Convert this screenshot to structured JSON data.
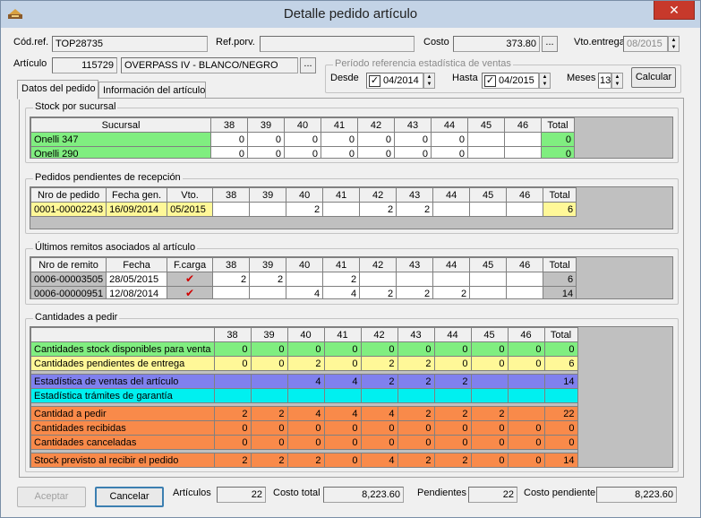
{
  "window": {
    "title": "Detalle pedido artículo",
    "close_label": "✕"
  },
  "header": {
    "codref_label": "Cód.ref.",
    "codref_value": "TOP28735",
    "refporv_label": "Ref.porv.",
    "refporv_value": "",
    "costo_label": "Costo",
    "costo_value": "373.80",
    "vto_label": "Vto.entrega",
    "vto_value": "08/2015",
    "articulo_label": "Artículo",
    "articulo_code": "115729",
    "articulo_desc": "OVERPASS IV - BLANCO/NEGRO",
    "dots_label": "...",
    "periodo_legend": "Período referencia estadística de ventas",
    "desde_label": "Desde",
    "desde_value": "04/2014",
    "hasta_label": "Hasta",
    "hasta_value": "04/2015",
    "meses_label": "Meses",
    "meses_value": "13",
    "calcular_label": "Calcular"
  },
  "tabs": [
    {
      "label": "Datos del pedido"
    },
    {
      "label": "Información del artículo"
    }
  ],
  "sizes": [
    "38",
    "39",
    "40",
    "41",
    "42",
    "43",
    "44",
    "45",
    "46"
  ],
  "total_label": "Total",
  "stock": {
    "legend": "Stock por sucursal",
    "col_label": "Sucursal",
    "rows": [
      {
        "name": "Onelli 347",
        "values": [
          "0",
          "0",
          "0",
          "0",
          "0",
          "0",
          "0",
          "",
          ""
        ],
        "total": "0"
      },
      {
        "name": "Onelli 290",
        "values": [
          "0",
          "0",
          "0",
          "0",
          "0",
          "0",
          "0",
          "",
          ""
        ],
        "total": "0"
      }
    ]
  },
  "pedidos": {
    "legend": "Pedidos pendientes de recepción",
    "cols": [
      "Nro de pedido",
      "Fecha gen.",
      "Vto."
    ],
    "rows": [
      {
        "nro": "0001-00002243",
        "fecha": "16/09/2014",
        "vto": "05/2015",
        "values": [
          "",
          "",
          "2",
          "",
          "2",
          "2",
          "",
          "",
          ""
        ],
        "total": "6"
      }
    ]
  },
  "remitos": {
    "legend": "Últimos remitos asociados al artículo",
    "cols": [
      "Nro de remito",
      "Fecha",
      "F.carga"
    ],
    "rows": [
      {
        "nro": "0006-00003505",
        "fecha": "28/05/2015",
        "fcarga_icon": "red-check-icon",
        "fcarga_glyph": "✔",
        "values": [
          "2",
          "2",
          "",
          "2",
          "",
          "",
          "",
          "",
          ""
        ],
        "total": "6"
      },
      {
        "nro": "0006-00000951",
        "fecha": "12/08/2014",
        "fcarga_icon": "red-check-icon",
        "fcarga_glyph": "✔",
        "values": [
          "",
          "",
          "4",
          "4",
          "2",
          "2",
          "2",
          "",
          ""
        ],
        "total": "14"
      }
    ]
  },
  "cantidades": {
    "legend": "Cantidades a pedir",
    "rows": [
      {
        "label": "Cantidades stock disponibles para venta",
        "color": "#80ee80",
        "values": [
          "0",
          "0",
          "0",
          "0",
          "0",
          "0",
          "0",
          "0",
          "0"
        ],
        "total": "0"
      },
      {
        "label": "Cantidades pendientes de entrega",
        "color": "#fff898",
        "values": [
          "0",
          "0",
          "2",
          "0",
          "2",
          "2",
          "0",
          "0",
          "0"
        ],
        "total": "6"
      },
      {
        "label": "Estadística de ventas del artículo",
        "color": "#8080ee",
        "values": [
          "",
          "",
          "4",
          "4",
          "2",
          "2",
          "2",
          "",
          ""
        ],
        "total": "14"
      },
      {
        "label": "Estadística trámites de garantía",
        "color": "#00f0f0",
        "values": [
          "",
          "",
          "",
          "",
          "",
          "",
          "",
          "",
          ""
        ],
        "total": ""
      },
      {
        "label": "Cantidad a pedir",
        "color": "#f98a4a",
        "values": [
          "2",
          "2",
          "4",
          "4",
          "4",
          "2",
          "2",
          "2",
          ""
        ],
        "total": "22"
      },
      {
        "label": "Cantidades recibidas",
        "color": "#f98a4a",
        "values": [
          "0",
          "0",
          "0",
          "0",
          "0",
          "0",
          "0",
          "0",
          "0"
        ],
        "total": "0"
      },
      {
        "label": "Cantidades canceladas",
        "color": "#f98a4a",
        "values": [
          "0",
          "0",
          "0",
          "0",
          "0",
          "0",
          "0",
          "0",
          "0"
        ],
        "total": "0"
      },
      {
        "label": "Stock previsto al recibir el pedido",
        "color": "#f98a4a",
        "values": [
          "2",
          "2",
          "2",
          "0",
          "4",
          "2",
          "2",
          "0",
          "0"
        ],
        "total": "14"
      }
    ]
  },
  "footer": {
    "aceptar_label": "Aceptar",
    "cancelar_label": "Cancelar",
    "articulos_label": "Artículos",
    "articulos_value": "22",
    "costo_total_label": "Costo total",
    "costo_total_value": "8,223.60",
    "pendientes_label": "Pendientes",
    "pendientes_value": "22",
    "costo_pend_label": "Costo pendiente",
    "costo_pend_value": "8,223.60"
  }
}
